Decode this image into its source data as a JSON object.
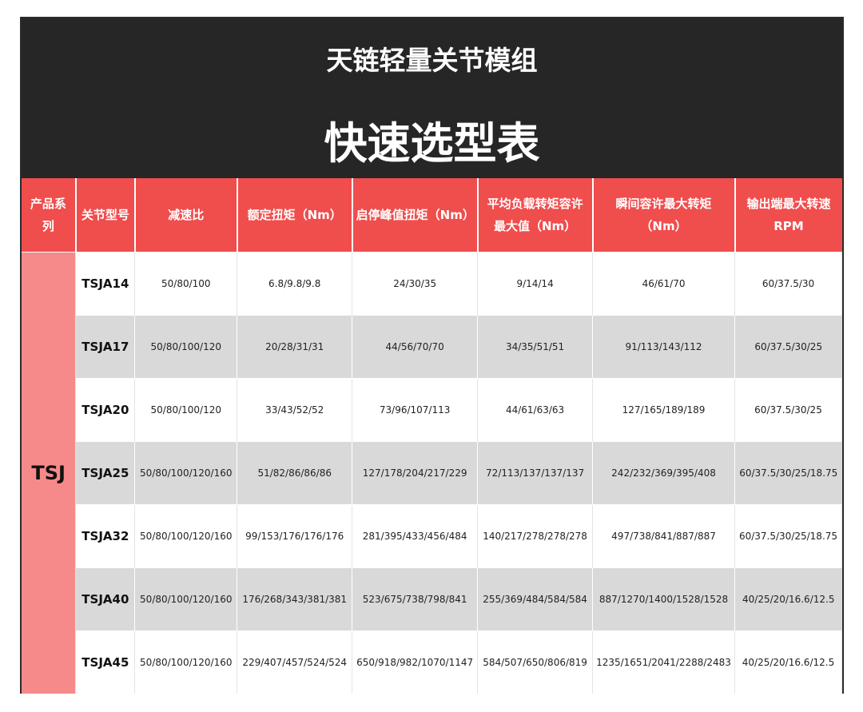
{
  "header": {
    "title_line1": "天链轻量关节模组",
    "title_line2": "快速选型表"
  },
  "columns": [
    "产品系列",
    "关节型号",
    "减速比",
    "额定扭矩（Nm）",
    "启停峰值扭矩（Nm）",
    "平均负载转矩容许最大值（Nm）",
    "瞬间容许最大转矩（Nm）",
    "输出端最大转速RPM"
  ],
  "series": "TSJ",
  "rows": [
    {
      "model": "TSJA14",
      "ratio": "50/80/100",
      "rated": "6.8/9.8/9.8",
      "peak": "24/30/35",
      "avg": "9/14/14",
      "instant": "46/61/70",
      "speed": "60/37.5/30"
    },
    {
      "model": "TSJA17",
      "ratio": "50/80/100/120",
      "rated": "20/28/31/31",
      "peak": "44/56/70/70",
      "avg": "34/35/51/51",
      "instant": "91/113/143/112",
      "speed": "60/37.5/30/25"
    },
    {
      "model": "TSJA20",
      "ratio": "50/80/100/120",
      "rated": "33/43/52/52",
      "peak": "73/96/107/113",
      "avg": "44/61/63/63",
      "instant": "127/165/189/189",
      "speed": "60/37.5/30/25"
    },
    {
      "model": "TSJA25",
      "ratio": "50/80/100/120/160",
      "rated": "51/82/86/86/86",
      "peak": "127/178/204/217/229",
      "avg": "72/113/137/137/137",
      "instant": "242/232/369/395/408",
      "speed": "60/37.5/30/25/18.75"
    },
    {
      "model": "TSJA32",
      "ratio": "50/80/100/120/160",
      "rated": "99/153/176/176/176",
      "peak": "281/395/433/456/484",
      "avg": "140/217/278/278/278",
      "instant": "497/738/841/887/887",
      "speed": "60/37.5/30/25/18.75"
    },
    {
      "model": "TSJA40",
      "ratio": "50/80/100/120/160",
      "rated": "176/268/343/381/381",
      "peak": "523/675/738/798/841",
      "avg": "255/369/484/584/584",
      "instant": "887/1270/1400/1528/1528",
      "speed": "40/25/20/16.6/12.5"
    },
    {
      "model": "TSJA45",
      "ratio": "50/80/100/120/160",
      "rated": "229/407/457/524/524",
      "peak": "650/918/982/1070/1147",
      "avg": "584/507/650/806/819",
      "instant": "1235/1651/2041/2288/2483",
      "speed": "40/25/20/16.6/12.5"
    }
  ]
}
